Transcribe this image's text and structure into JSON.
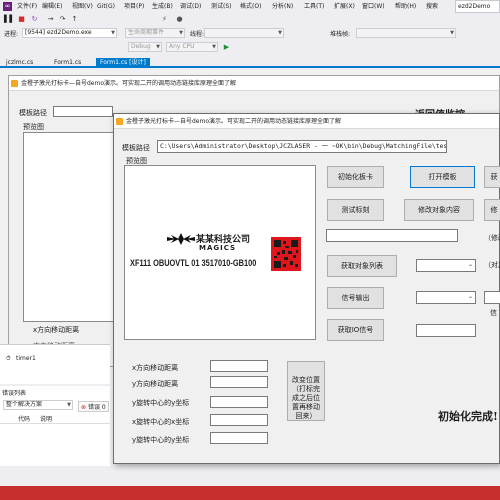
{
  "menu": {
    "items": [
      "文件(F)",
      "编辑(E)",
      "视图(V)",
      "Git(G)",
      "项目(P)",
      "生成(B)",
      "调试(D)",
      "测试(S)",
      "格式(O)",
      "分析(N)",
      "工具(T)",
      "扩展(X)",
      "窗口(W)",
      "帮助(H)"
    ],
    "search_label": "搜索",
    "window_title": "ezd2Demo"
  },
  "toolbar": {
    "process_label": "进程:",
    "process_value": "[9544] ezd2Demo.exe",
    "lifecycle_value": "生命周期事件",
    "thread_label": "线程:",
    "stack_label": "堆栈帧:",
    "config_value": "Debug",
    "platform_value": "Any CPU"
  },
  "tabs": [
    "jczlmc.cs",
    "Form1.cs",
    "Form1.cs [设计]"
  ],
  "back_form": {
    "title": "金橙子激光打标卡—自号demo演示。可实现二开的调用动态链接库原理全面了解",
    "path_label": "模板路径",
    "preview_label": "预览图",
    "return_label": "返回值监控",
    "x_label": "x方向移动距离",
    "y_label": "方向移动距离"
  },
  "front_form": {
    "title": "金橙子激光打标卡—自号demo演示。可实现二开的调用动态链接库原理全面了解",
    "path_label": "模板路径",
    "path_value": "C:\\Users\\Administrator\\Desktop\\JCZLASER - 一 ~OK\\bin\\Debug\\MatchingFile\\test.ezd",
    "preview_label": "预览图",
    "preview_company": "某某科技公司",
    "preview_brand": "MAGICS",
    "preview_code": "XF111 OBUOVTL 01 3517010-GB100",
    "buttons": {
      "init_card": "初始化板卡",
      "open_template": "打开模板",
      "test_mark": "测试标刻",
      "modify_content": "修改对象内容",
      "get_objects": "获取对象列表",
      "signal_output": "信号输出",
      "get_io": "获取IO信号",
      "change_position": "改变位置（打标完成之后位置再移动回来）"
    },
    "side_labels": {
      "modify_hint": "（修改",
      "align_hint": "（对其",
      "signal_hint": "信"
    },
    "fields": {
      "x_move": "x方向移动距离",
      "y_move": "y方向移动距离",
      "y_rot": "y旋转中心的y坐标",
      "x_rot": "x旋转中心的x坐标",
      "y_rot2": "y旋转中心的y坐标"
    },
    "status_text": "初始化完成!"
  },
  "timer": {
    "label": "timer1"
  },
  "error_list": {
    "title": "错误列表",
    "scope": "整个解决方案",
    "errors": "错误 0",
    "col_code": "代码",
    "col_desc": "说明"
  },
  "colors": {
    "accent": "#007acc",
    "status": "#c72e2e",
    "vs_logo": "#68217a"
  }
}
